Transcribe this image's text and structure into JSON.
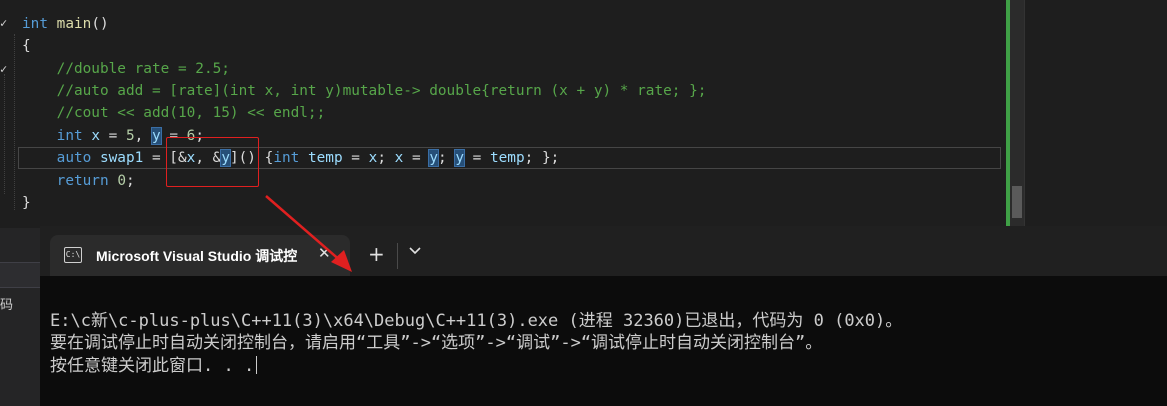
{
  "editor": {
    "lines": [
      {
        "parts": [
          [
            "kw",
            "int"
          ],
          [
            "plain",
            " "
          ],
          [
            "fn",
            "main"
          ],
          [
            "plain",
            "()"
          ]
        ]
      },
      {
        "parts": [
          [
            "plain",
            "{"
          ]
        ]
      },
      {
        "parts": [
          [
            "plain",
            "    "
          ],
          [
            "cm",
            "//double rate = 2.5;"
          ]
        ]
      },
      {
        "parts": [
          [
            "plain",
            "    "
          ],
          [
            "cm",
            "//auto add = [rate](int x, int y)mutable-> double{return (x + y) * rate; };"
          ]
        ]
      },
      {
        "parts": [
          [
            "plain",
            "    "
          ],
          [
            "cm",
            "//cout << add(10, 15) << endl;;"
          ]
        ]
      },
      {
        "parts": [
          [
            "plain",
            "    "
          ],
          [
            "kw",
            "int"
          ],
          [
            "plain",
            " "
          ],
          [
            "var",
            "x"
          ],
          [
            "plain",
            " = "
          ],
          [
            "num",
            "5"
          ],
          [
            "plain",
            ", "
          ],
          [
            "varhl",
            "y"
          ],
          [
            "plain",
            " = "
          ],
          [
            "num",
            "6"
          ],
          [
            "plain",
            ";"
          ]
        ]
      },
      {
        "parts": [
          [
            "plain",
            "    "
          ],
          [
            "kw",
            "auto"
          ],
          [
            "plain",
            " "
          ],
          [
            "var",
            "swap1"
          ],
          [
            "plain",
            " = [&"
          ],
          [
            "var",
            "x"
          ],
          [
            "plain",
            ", &"
          ],
          [
            "varhl",
            "y"
          ],
          [
            "plain",
            "]() {"
          ],
          [
            "kw",
            "int"
          ],
          [
            "plain",
            " "
          ],
          [
            "var",
            "temp"
          ],
          [
            "plain",
            " = "
          ],
          [
            "var",
            "x"
          ],
          [
            "plain",
            "; "
          ],
          [
            "var",
            "x"
          ],
          [
            "plain",
            " = "
          ],
          [
            "varhl",
            "y"
          ],
          [
            "plain",
            "; "
          ],
          [
            "varhl",
            "y"
          ],
          [
            "plain",
            " = "
          ],
          [
            "var",
            "temp"
          ],
          [
            "plain",
            "; };"
          ]
        ]
      },
      {
        "parts": [
          [
            "plain",
            "    "
          ],
          [
            "kw",
            "return"
          ],
          [
            "plain",
            " "
          ],
          [
            "num",
            "0"
          ],
          [
            "plain",
            ";"
          ]
        ]
      },
      {
        "parts": [
          [
            "plain",
            "}"
          ]
        ]
      }
    ],
    "gutter_marks": [
      "✓",
      "✓"
    ]
  },
  "left_strip_label": "码",
  "terminal": {
    "tab_icon": "C:\\",
    "tab_title": "Microsoft Visual Studio 调试控",
    "close_glyph": "✕",
    "new_tab_glyph": "+",
    "output_lines": [
      "E:\\c新\\c-plus-plus\\C++11(3)\\x64\\Debug\\C++11(3).exe (进程 32360)已退出，代码为 0 (0x0)。",
      "要在调试停止时自动关闭控制台，请启用“工具”->“选项”->“调试”->“调试停止时自动关闭控制台”。",
      "按任意键关闭此窗口. . ."
    ]
  },
  "colors": {
    "keyword": "#569cd6",
    "comment": "#57a64a",
    "annotation": "#e02020",
    "scrollbar_accent": "#3fa046"
  }
}
